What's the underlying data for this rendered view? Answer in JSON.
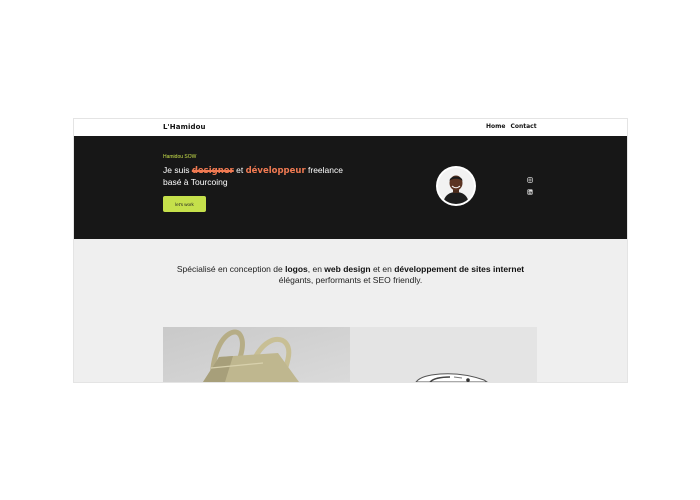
{
  "nav": {
    "logo": "L'Hamidou",
    "links": [
      "Home",
      "Contact"
    ]
  },
  "hero": {
    "name": "Hamidou SOW",
    "headline": {
      "prefix": "Je suis ",
      "word1": "designer",
      "mid": " et ",
      "word2": "développeur",
      "suffix": " freelance basé à Tourcoing"
    },
    "cta_label": "let's work",
    "social_icons": [
      "instagram-icon",
      "linkedin-icon"
    ]
  },
  "intro": {
    "t1": "Spécialisé en conception de ",
    "b1": "logos",
    "t2": ", en ",
    "b2": "web design",
    "t3": " et en ",
    "b3": "développement de sites internet",
    "t4": " élégants, performants et SEO friendly."
  },
  "colors": {
    "hero_bg": "#171717",
    "accent_green": "#c5e04b",
    "accent_orange": "#f07a52",
    "page_bg": "#efefef"
  }
}
